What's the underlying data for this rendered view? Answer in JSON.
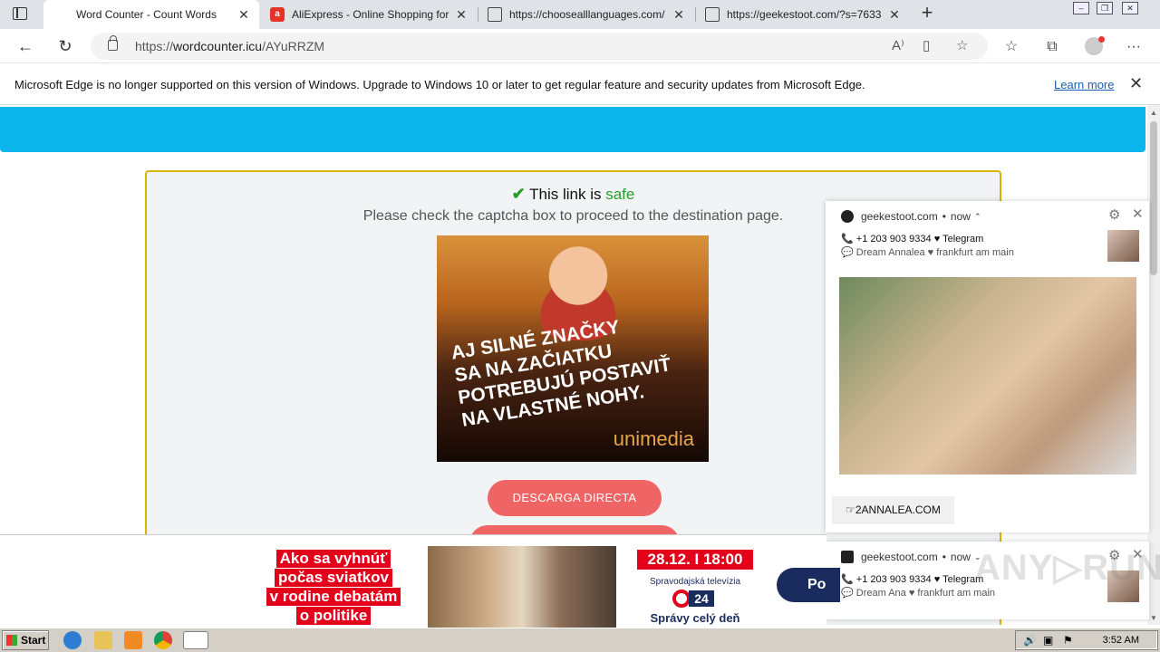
{
  "browser": {
    "tabs": [
      {
        "title": "Word Counter - Count Words",
        "active": true,
        "favicon": "none"
      },
      {
        "title": "AliExpress - Online Shopping for",
        "favicon": "aliexpress-icon"
      },
      {
        "title": "https://choosealllanguages.com/",
        "favicon": "document-icon"
      },
      {
        "title": "https://geekestoot.com/?s=7633",
        "favicon": "document-icon"
      }
    ],
    "url": {
      "scheme": "https://",
      "host": "wordcounter.icu",
      "path": "/AYuRRZM"
    }
  },
  "infobar": {
    "message": "Microsoft Edge is no longer supported on this version of Windows. Upgrade to Windows 10 or later to get regular feature and security updates from Microsoft Edge.",
    "link": "Learn more"
  },
  "page": {
    "safe_prefix": "This link is ",
    "safe_word": "safe",
    "instruction": "Please check the captcha box to proceed to the destination page.",
    "ad": {
      "headline": [
        "AJ SILNÉ ZNAČKY",
        "SA NA ZAČIATKU",
        "POTREBUJÚ POSTAVIŤ",
        "NA VLASTNÉ NOHY."
      ],
      "brand": "unimedia"
    },
    "download_button": "DESCARGA DIRECTA"
  },
  "notifications": [
    {
      "source": "geekestoot.com",
      "time": "now",
      "line1": "+1 203 903 9334 ♥ Telegram",
      "line2": "Dream Annalea ♥ frankfurt am main",
      "cta": "☞2ANNALEA.COM"
    },
    {
      "source": "geekestoot.com",
      "time": "now",
      "line1": "+1 203 903 9334 ♥ Telegram",
      "line2": "Dream Ana ♥ frankfurt am main"
    }
  ],
  "bottom_ad": {
    "text_lines": [
      "Ako sa vyhnúť",
      "počas sviatkov",
      "v rodine debatám",
      "o politike"
    ],
    "date": "28.12. I 18:00",
    "station": "Spravodajská televízia",
    "logo": "24",
    "slogan": "Správy celý deň",
    "button": "Po"
  },
  "taskbar": {
    "start": "Start",
    "clock": "3:52 AM"
  },
  "colors": {
    "accent_blue": "#0db5ed",
    "safe_green": "#2a9d2a",
    "button_red": "#ef6565",
    "card_border": "#d9b500"
  }
}
